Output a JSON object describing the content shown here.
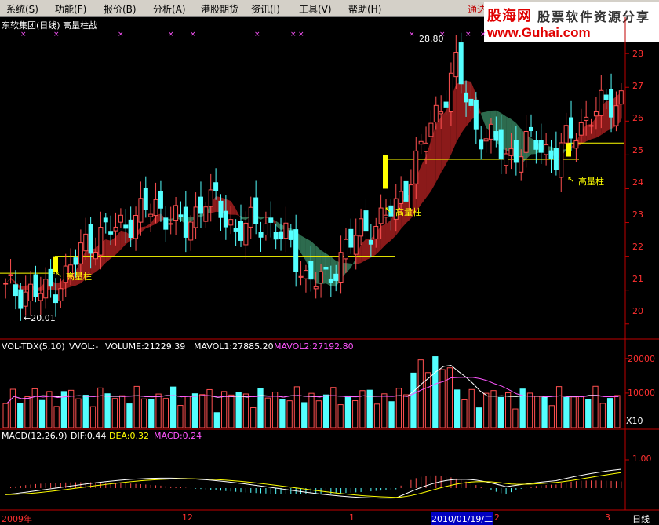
{
  "menu": {
    "items": [
      "系统(S)",
      "功能(F)",
      "报价(B)",
      "分析(A)",
      "港股期货",
      "资讯(I)",
      "工具(V)",
      "帮助(H)"
    ],
    "extra": "通达"
  },
  "watermark": {
    "line1": "股海网",
    "line1b": "股票软件资源分享",
    "line2": "www.Guhai.com"
  },
  "header": {
    "title": "东软集团(日线) 高量柱战"
  },
  "price_panel": {
    "high_label": "28.80",
    "low_label": "←20.01",
    "annotation": "高量柱",
    "ticks": [
      20,
      21,
      22,
      23,
      24,
      25,
      26,
      27,
      28
    ]
  },
  "vol_panel": {
    "legend": {
      "name": "VOL-TDX(5,10)",
      "vvol": "VVOL:-",
      "volume": "VOLUME:21229.39",
      "mavol1": "MAVOL1:27885.20",
      "mavol2": "MAVOL2:27192.80"
    },
    "ticks": [
      10000,
      20000
    ],
    "scale": "X10"
  },
  "macd_panel": {
    "legend": {
      "name": "MACD(12,26,9)",
      "dif": "DIF:0.44",
      "dea": "DEA:0.32",
      "macd": "MACD:0.24"
    },
    "ticks": [
      "1.00"
    ]
  },
  "footer": {
    "labels": [
      "2009年",
      "12",
      "1",
      "2",
      "3"
    ],
    "cursor_date": "2010/01/19/二",
    "period": "日线"
  },
  "colors": {
    "up": "#ff5050",
    "down": "#54ffff",
    "ma1": "#ffffff",
    "ma2": "#ff55ff",
    "band_up": "#8b1a1a",
    "band_down": "#2d6b4e",
    "yellow": "#ffff00",
    "axis": "#c00000"
  },
  "chart_data": [
    {
      "type": "candlestick",
      "title": "东软集团(日线) 高量柱战",
      "yticks": [
        20,
        21,
        22,
        23,
        24,
        25,
        26,
        27,
        28
      ],
      "ylim": [
        19.6,
        28.7
      ],
      "high": 28.8,
      "low": 20.01,
      "support_lines": [
        21.5,
        22.0,
        24.87,
        25.35
      ],
      "annotations": [
        "高量柱",
        "高量柱",
        "高量柱"
      ]
    },
    {
      "type": "bar",
      "title": "VOL-TDX(5,10)",
      "series": [
        {
          "name": "VOLUME",
          "last": 21229.39
        },
        {
          "name": "MAVOL1",
          "last": 27885.2
        },
        {
          "name": "MAVOL2",
          "last": 27192.8
        }
      ],
      "yticks": [
        10000,
        20000
      ],
      "ylabel_suffix": "X10"
    },
    {
      "type": "line",
      "title": "MACD(12,26,9)",
      "series": [
        {
          "name": "DIF",
          "last": 0.44
        },
        {
          "name": "DEA",
          "last": 0.32
        },
        {
          "name": "MACD",
          "last": 0.24
        }
      ],
      "yticks": [
        1.0
      ]
    }
  ]
}
